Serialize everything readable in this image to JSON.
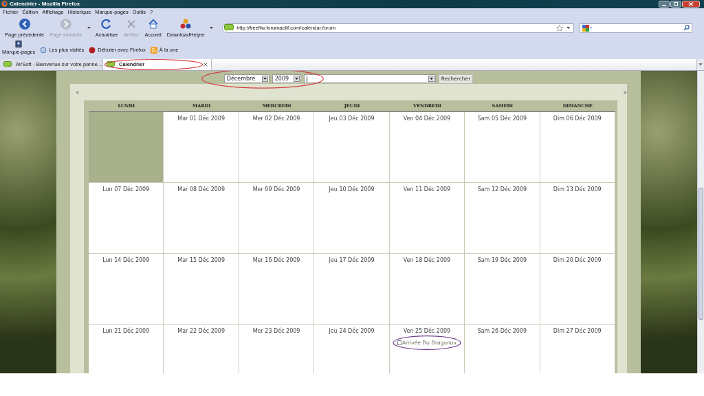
{
  "window": {
    "title": "Calendrier - Mozilla Firefox"
  },
  "menu": [
    "Fichier",
    "Édition",
    "Affichage",
    "Historique",
    "Marque-pages",
    "Outils",
    "?"
  ],
  "nav_buttons": [
    {
      "kind": "back",
      "label": "Page précédente",
      "disabled": false
    },
    {
      "kind": "forward",
      "label": "Page suivante",
      "disabled": true
    },
    {
      "kind": "reload",
      "label": "Actualiser",
      "disabled": false
    },
    {
      "kind": "stop",
      "label": "Arrêter",
      "disabled": true
    },
    {
      "kind": "home",
      "label": "Accueil",
      "disabled": false
    },
    {
      "kind": "addon",
      "label": "DownloadHelper",
      "disabled": false
    }
  ],
  "address_bar": {
    "value": "http://freeftw.forumactif.com/calendar.forum"
  },
  "bookmarks": [
    {
      "kind": "menu",
      "label": "Marque-pages"
    },
    {
      "kind": "search",
      "label": "Les plus visités"
    },
    {
      "kind": "firefox",
      "label": "Débuter avec Firefox"
    },
    {
      "kind": "feed",
      "label": "À la une"
    }
  ],
  "tabs": [
    {
      "label": "AirSoft - Bienvenue sur votre panne...",
      "selected": false,
      "circled": false
    },
    {
      "label": "Calendrier",
      "selected": true,
      "circled": true
    }
  ],
  "calendar": {
    "month": "Décembre",
    "year": "2009",
    "search_button": "Rechercher",
    "filter_circled": true,
    "prev": "«",
    "next": "»",
    "columns": [
      "LUNDI",
      "MARDI",
      "MERCREDI",
      "JEUDI",
      "VENDREDI",
      "SAMEDI",
      "DIMANCHE"
    ],
    "weeks": [
      [
        {
          "kind": "blank"
        },
        {
          "kind": "day",
          "date": "Mar 01 Déc 2009"
        },
        {
          "kind": "day",
          "date": "Mer 02 Déc 2009"
        },
        {
          "kind": "day",
          "date": "Jeu 03 Déc 2009"
        },
        {
          "kind": "day",
          "date": "Ven 04 Déc 2009"
        },
        {
          "kind": "day",
          "date": "Sam 05 Déc 2009"
        },
        {
          "kind": "day",
          "date": "Dim 06 Déc 2009"
        }
      ],
      [
        {
          "kind": "day",
          "date": "Lun 07 Déc 2009"
        },
        {
          "kind": "day",
          "date": "Mar 08 Déc 2009"
        },
        {
          "kind": "day",
          "date": "Mer 09 Déc 2009"
        },
        {
          "kind": "day",
          "date": "Jeu 10 Déc 2009"
        },
        {
          "kind": "day",
          "date": "Ven 11 Déc 2009"
        },
        {
          "kind": "day",
          "date": "Sam 12 Déc 2009"
        },
        {
          "kind": "day",
          "date": "Dim 13 Déc 2009"
        }
      ],
      [
        {
          "kind": "day",
          "date": "Lun 14 Déc 2009"
        },
        {
          "kind": "day",
          "date": "Mar 15 Déc 2009"
        },
        {
          "kind": "day",
          "date": "Mer 16 Déc 2009"
        },
        {
          "kind": "day",
          "date": "Jeu 17 Déc 2009"
        },
        {
          "kind": "day",
          "date": "Ven 18 Déc 2009"
        },
        {
          "kind": "day",
          "date": "Sam 19 Déc 2009"
        },
        {
          "kind": "day",
          "date": "Dim 20 Déc 2009"
        }
      ],
      [
        {
          "kind": "day",
          "date": "Lun 21 Déc 2009"
        },
        {
          "kind": "day",
          "date": "Mar 22 Déc 2009"
        },
        {
          "kind": "day",
          "date": "Mer 23 Déc 2009"
        },
        {
          "kind": "day",
          "date": "Jeu 24 Déc 2009"
        },
        {
          "kind": "day",
          "date": "Ven 25 Déc 2009",
          "event": {
            "title": "Arrivée Du Dragunov",
            "circled": true
          }
        },
        {
          "kind": "day",
          "date": "Sam 26 Déc 2009"
        },
        {
          "kind": "day",
          "date": "Dim 27 Déc 2009"
        }
      ]
    ]
  }
}
